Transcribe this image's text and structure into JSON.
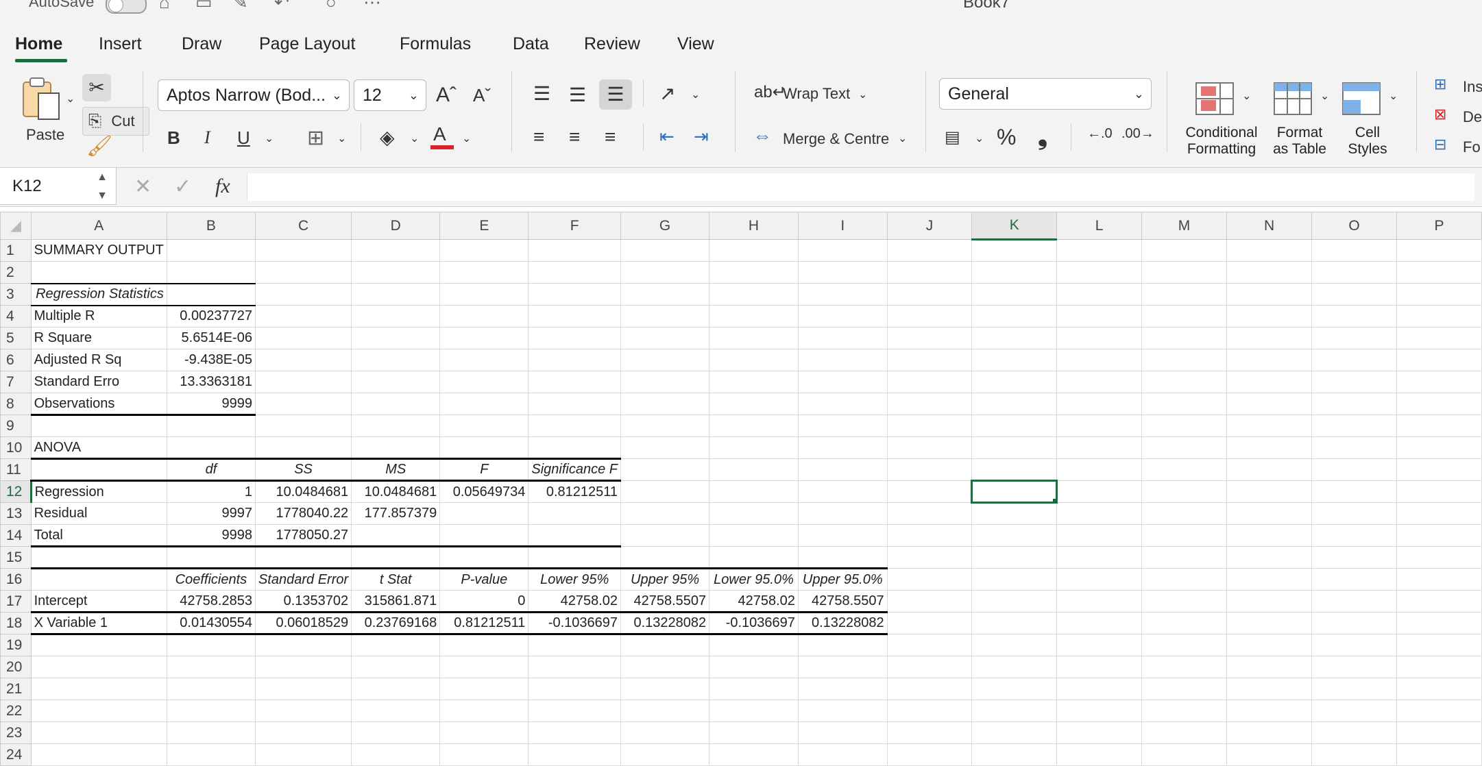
{
  "titlebar": {
    "autosave": "AutoSave",
    "doc_title": "Book7"
  },
  "tabs": [
    "Home",
    "Insert",
    "Draw",
    "Page Layout",
    "Formulas",
    "Data",
    "Review",
    "View"
  ],
  "ribbon": {
    "paste": "Paste",
    "cut_tooltip": "Cut",
    "font_name": "Aptos Narrow (Bod...",
    "font_size": "12",
    "bold": "B",
    "italic": "I",
    "underline": "U",
    "wrap_text": "Wrap Text",
    "merge_centre": "Merge & Centre",
    "number_format": "General",
    "percent": "%",
    "comma": "❟",
    "conditional_formatting": [
      "Conditional",
      "Formatting"
    ],
    "format_as_table": [
      "Format",
      "as Table"
    ],
    "cell_styles": [
      "Cell",
      "Styles"
    ],
    "insert": "Ins",
    "delete": "De",
    "format": "Fo"
  },
  "formula_bar": {
    "name_box": "K12",
    "fx": "fx",
    "value": ""
  },
  "columns": [
    "A",
    "B",
    "C",
    "D",
    "E",
    "F",
    "G",
    "H",
    "I",
    "J",
    "K",
    "L",
    "M",
    "N",
    "O",
    "P"
  ],
  "selected_cell": {
    "column": "K",
    "row": 12
  },
  "rows": [
    [
      "SUMMARY OUTPUT",
      "",
      "",
      "",
      "",
      "",
      "",
      "",
      ""
    ],
    [
      "",
      "",
      "",
      "",
      "",
      "",
      "",
      "",
      ""
    ],
    [
      "Regression Statistics",
      "",
      "",
      "",
      "",
      "",
      "",
      "",
      ""
    ],
    [
      "Multiple R",
      "0.00237727",
      "",
      "",
      "",
      "",
      "",
      "",
      ""
    ],
    [
      "R Square",
      "5.6514E-06",
      "",
      "",
      "",
      "",
      "",
      "",
      ""
    ],
    [
      "Adjusted R Sq",
      "-9.438E-05",
      "",
      "",
      "",
      "",
      "",
      "",
      ""
    ],
    [
      "Standard Erro",
      "13.3363181",
      "",
      "",
      "",
      "",
      "",
      "",
      ""
    ],
    [
      "Observations",
      "9999",
      "",
      "",
      "",
      "",
      "",
      "",
      ""
    ],
    [
      "",
      "",
      "",
      "",
      "",
      "",
      "",
      "",
      ""
    ],
    [
      "ANOVA",
      "",
      "",
      "",
      "",
      "",
      "",
      "",
      ""
    ],
    [
      "",
      "df",
      "SS",
      "MS",
      "F",
      "Significance F",
      "",
      "",
      ""
    ],
    [
      "Regression",
      "1",
      "10.0484681",
      "10.0484681",
      "0.05649734",
      "0.81212511",
      "",
      "",
      ""
    ],
    [
      "Residual",
      "9997",
      "1778040.22",
      "177.857379",
      "",
      "",
      "",
      "",
      ""
    ],
    [
      "Total",
      "9998",
      "1778050.27",
      "",
      "",
      "",
      "",
      "",
      ""
    ],
    [
      "",
      "",
      "",
      "",
      "",
      "",
      "",
      "",
      ""
    ],
    [
      "",
      "Coefficients",
      "Standard Error",
      "t Stat",
      "P-value",
      "Lower 95%",
      "Upper 95%",
      "Lower 95.0%",
      "Upper 95.0%"
    ],
    [
      "Intercept",
      "42758.2853",
      "0.1353702",
      "315861.871",
      "0",
      "42758.02",
      "42758.5507",
      "42758.02",
      "42758.5507"
    ],
    [
      "X Variable 1",
      "0.01430554",
      "0.06018529",
      "0.23769168",
      "0.81212511",
      "-0.1036697",
      "0.13228082",
      "-0.1036697",
      "0.13228082"
    ],
    [
      "",
      "",
      "",
      "",
      "",
      "",
      "",
      "",
      ""
    ],
    [
      "",
      "",
      "",
      "",
      "",
      "",
      "",
      "",
      ""
    ],
    [
      "",
      "",
      "",
      "",
      "",
      "",
      "",
      "",
      ""
    ],
    [
      "",
      "",
      "",
      "",
      "",
      "",
      "",
      "",
      ""
    ],
    [
      "",
      "",
      "",
      "",
      "",
      "",
      "",
      "",
      ""
    ],
    [
      "",
      "",
      "",
      "",
      "",
      "",
      "",
      "",
      ""
    ]
  ],
  "colors": {
    "accent": "#1e6b3f",
    "font_color_bar": "#d9242b"
  }
}
